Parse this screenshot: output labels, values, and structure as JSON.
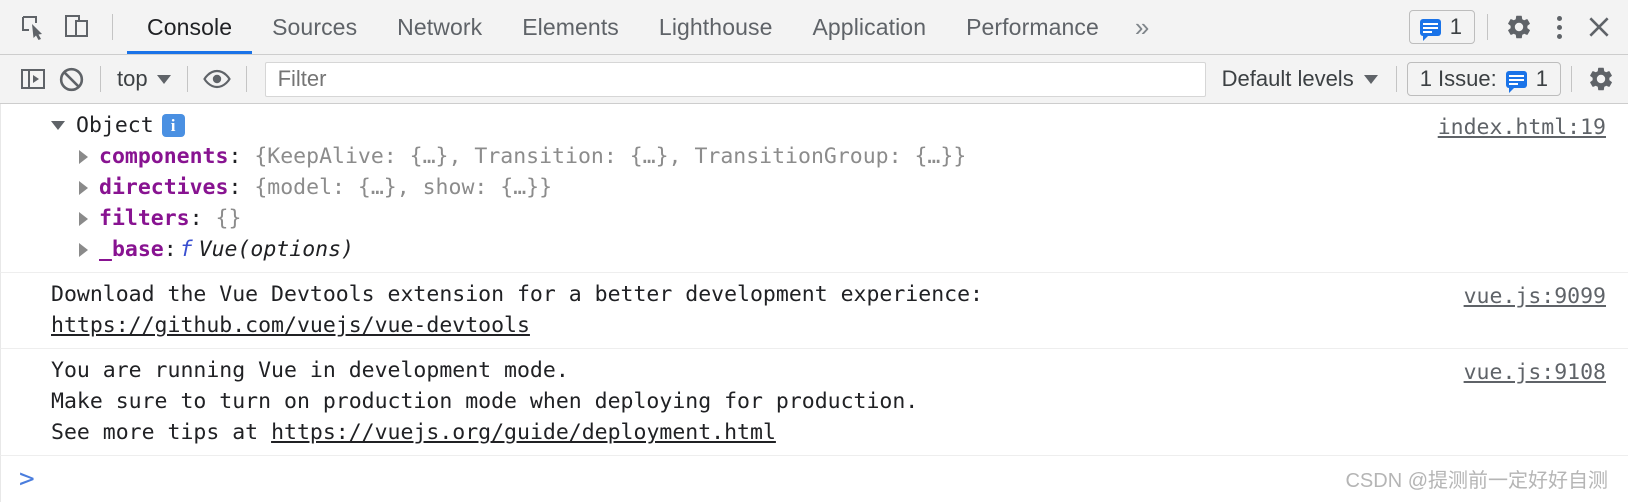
{
  "tabbar": {
    "icons": {
      "inspect": "inspect-element-icon",
      "device": "device-toolbar-icon",
      "settings": "gear-icon",
      "more": "kebab-menu-icon",
      "close": "close-icon"
    },
    "tabs": [
      {
        "label": "Console",
        "active": true
      },
      {
        "label": "Sources",
        "active": false
      },
      {
        "label": "Network",
        "active": false
      },
      {
        "label": "Elements",
        "active": false
      },
      {
        "label": "Lighthouse",
        "active": false
      },
      {
        "label": "Application",
        "active": false
      },
      {
        "label": "Performance",
        "active": false
      }
    ],
    "overflow_label": "»",
    "message_count": "1"
  },
  "toolbar": {
    "sidebar_toggle": "console-sidebar-icon",
    "clear_console": "clear-console-icon",
    "context": "top",
    "eye": "live-expression-icon",
    "filter_placeholder": "Filter",
    "levels": "Default levels",
    "issues_label": "1 Issue:",
    "issues_count": "1",
    "settings": "gear-icon"
  },
  "console": {
    "messages": [
      {
        "type": "object",
        "source": "index.html:19",
        "root_label": "Object",
        "props": [
          {
            "name": "components",
            "value": "{KeepAlive: {…}, Transition: {…}, TransitionGroup: {…}}"
          },
          {
            "name": "directives",
            "value": "{model: {…}, show: {…}}"
          },
          {
            "name": "filters",
            "value": "{}"
          },
          {
            "name": "_base",
            "keyword": "f",
            "fnname": "Vue(options)"
          }
        ]
      },
      {
        "type": "text",
        "source": "vue.js:9099",
        "lines": [
          {
            "text": "Download the Vue Devtools extension for a better development experience:",
            "link": false
          },
          {
            "text": "https://github.com/vuejs/vue-devtools",
            "link": true
          }
        ]
      },
      {
        "type": "text",
        "source": "vue.js:9108",
        "lines": [
          {
            "text": "You are running Vue in development mode.",
            "link": false
          },
          {
            "text": "Make sure to turn on production mode when deploying for production.",
            "link": false
          },
          {
            "prefix": "See more tips at ",
            "text": "https://vuejs.org/guide/deployment.html",
            "link": true
          }
        ]
      }
    ],
    "prompt_symbol": ">",
    "watermark": "CSDN @提测前一定好好自测"
  },
  "colors": {
    "accent": "#1a73e8",
    "property": "#881391",
    "value": "#8c8c8c",
    "keyword": "#3a4fd0",
    "prompt": "#4a7ddd"
  }
}
